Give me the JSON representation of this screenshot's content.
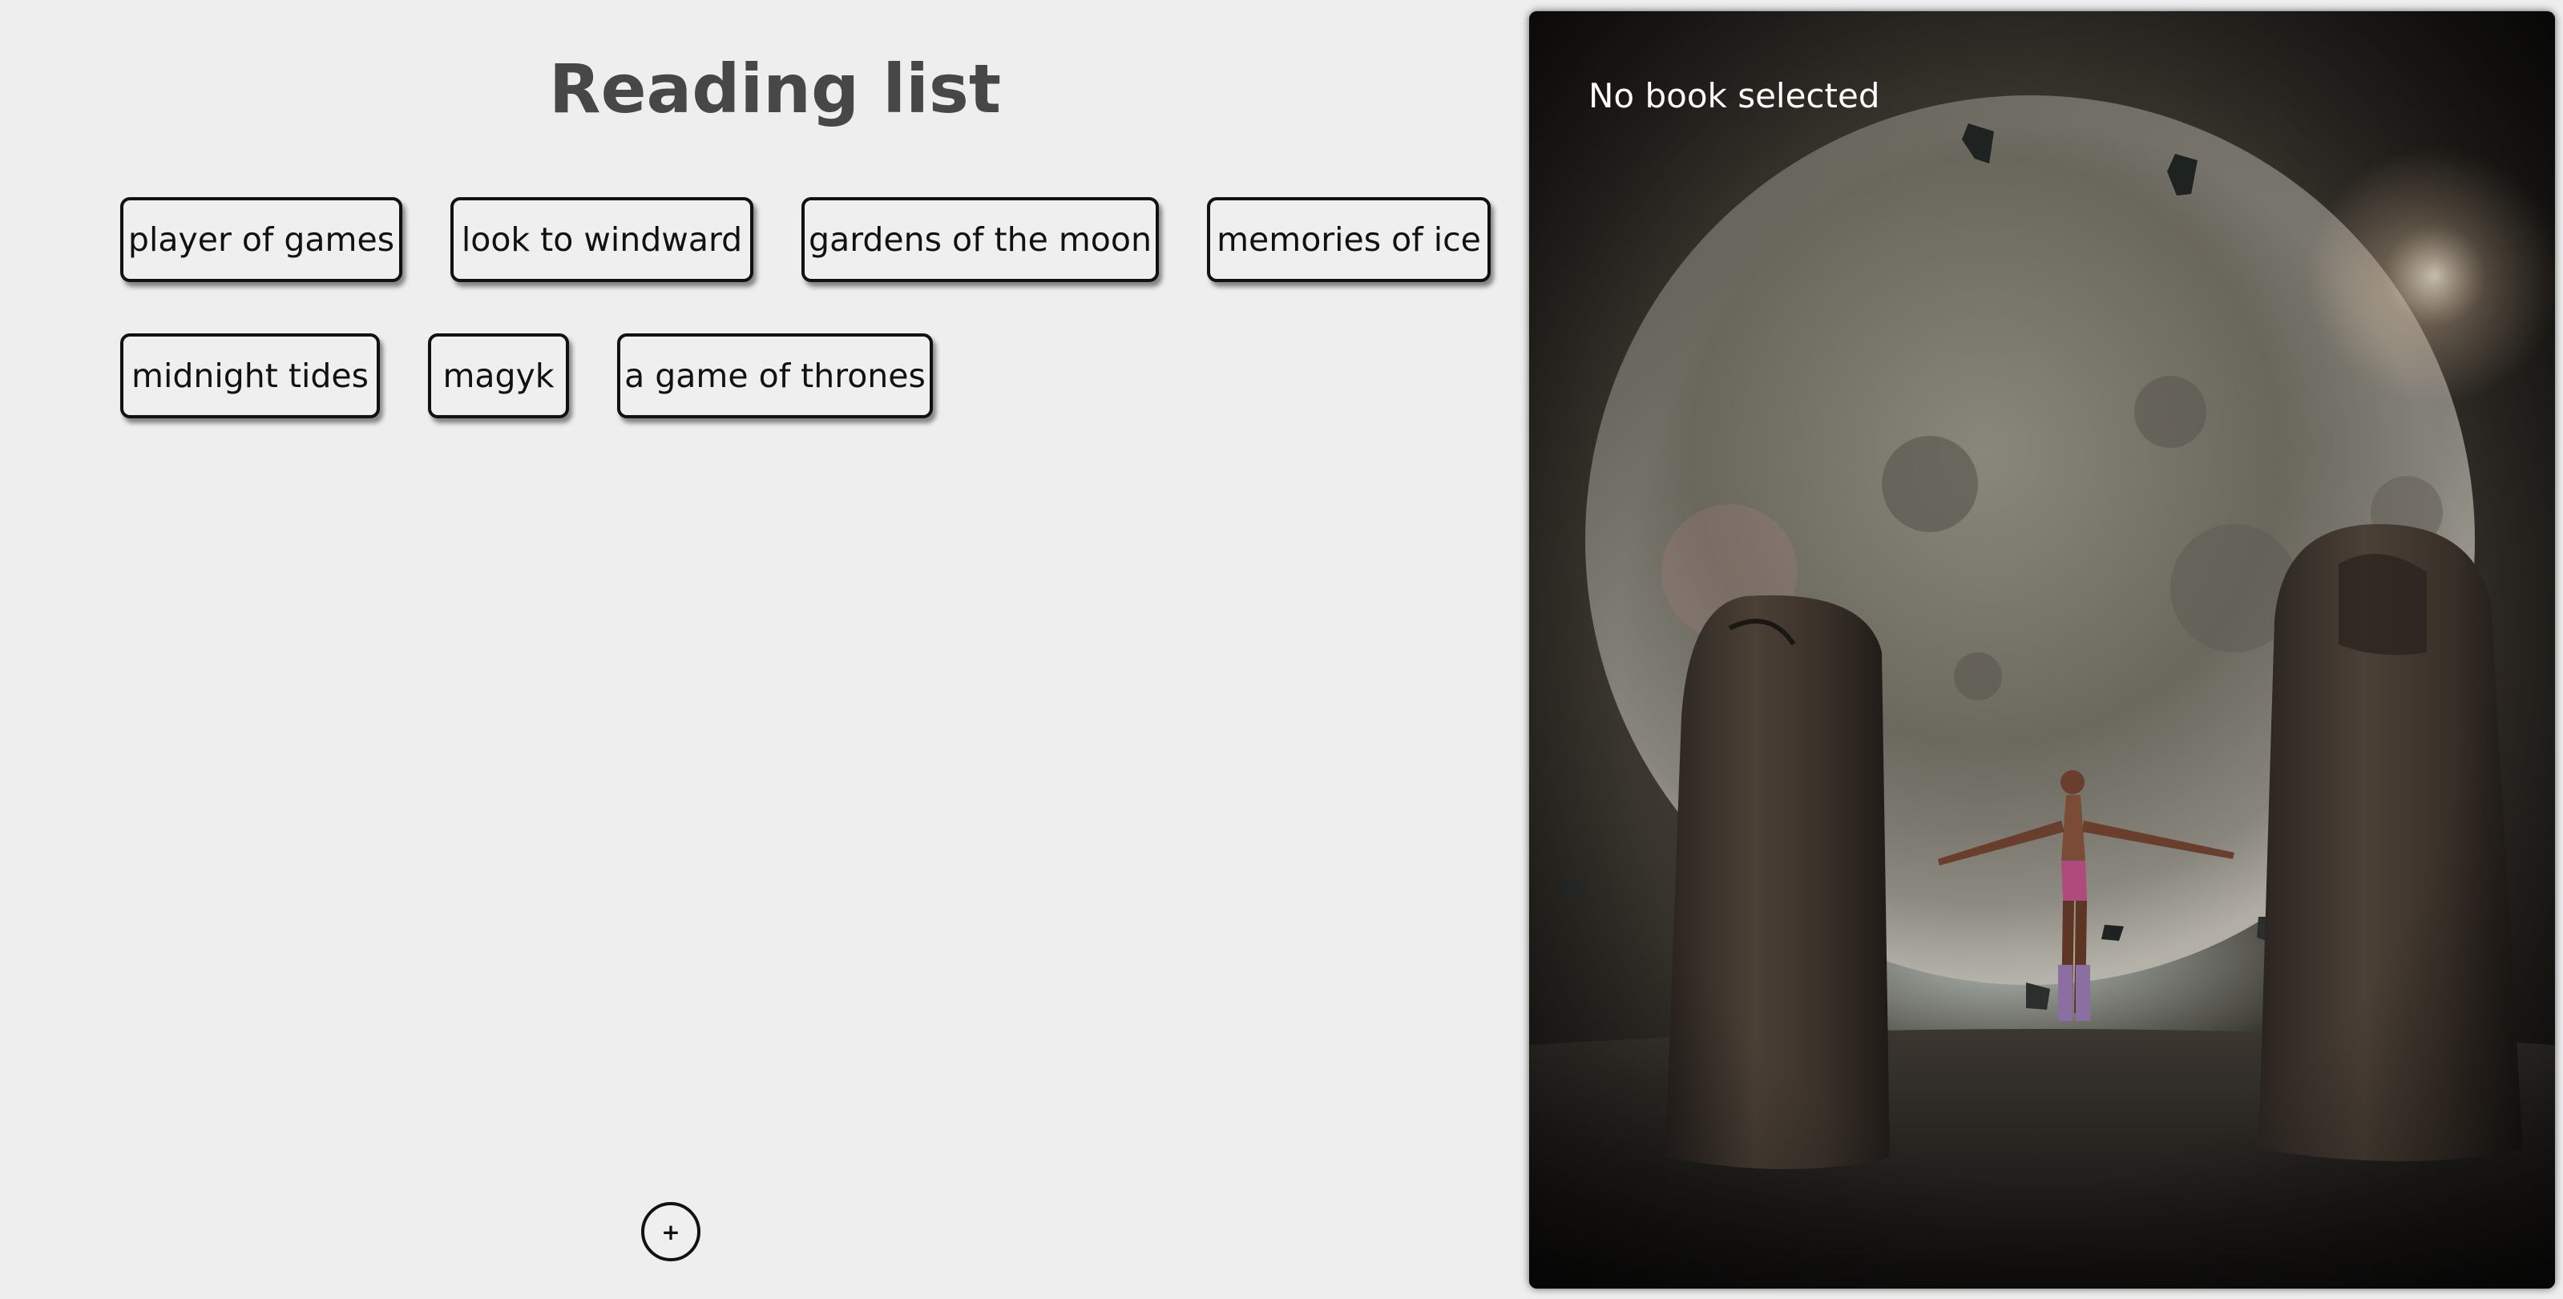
{
  "page": {
    "title": "Reading list"
  },
  "books": [
    "player of games",
    "look to windward",
    "gardens of the moon",
    "memories of ice",
    "midnight tides",
    "magyk",
    "a game of thrones"
  ],
  "add_button": {
    "label": "+"
  },
  "detail": {
    "status_text": "No book selected",
    "background": "fantasy-scene-moon-standing-stones"
  },
  "colors": {
    "background": "#eeeeee",
    "title": "#474747",
    "button_border": "#111111"
  }
}
